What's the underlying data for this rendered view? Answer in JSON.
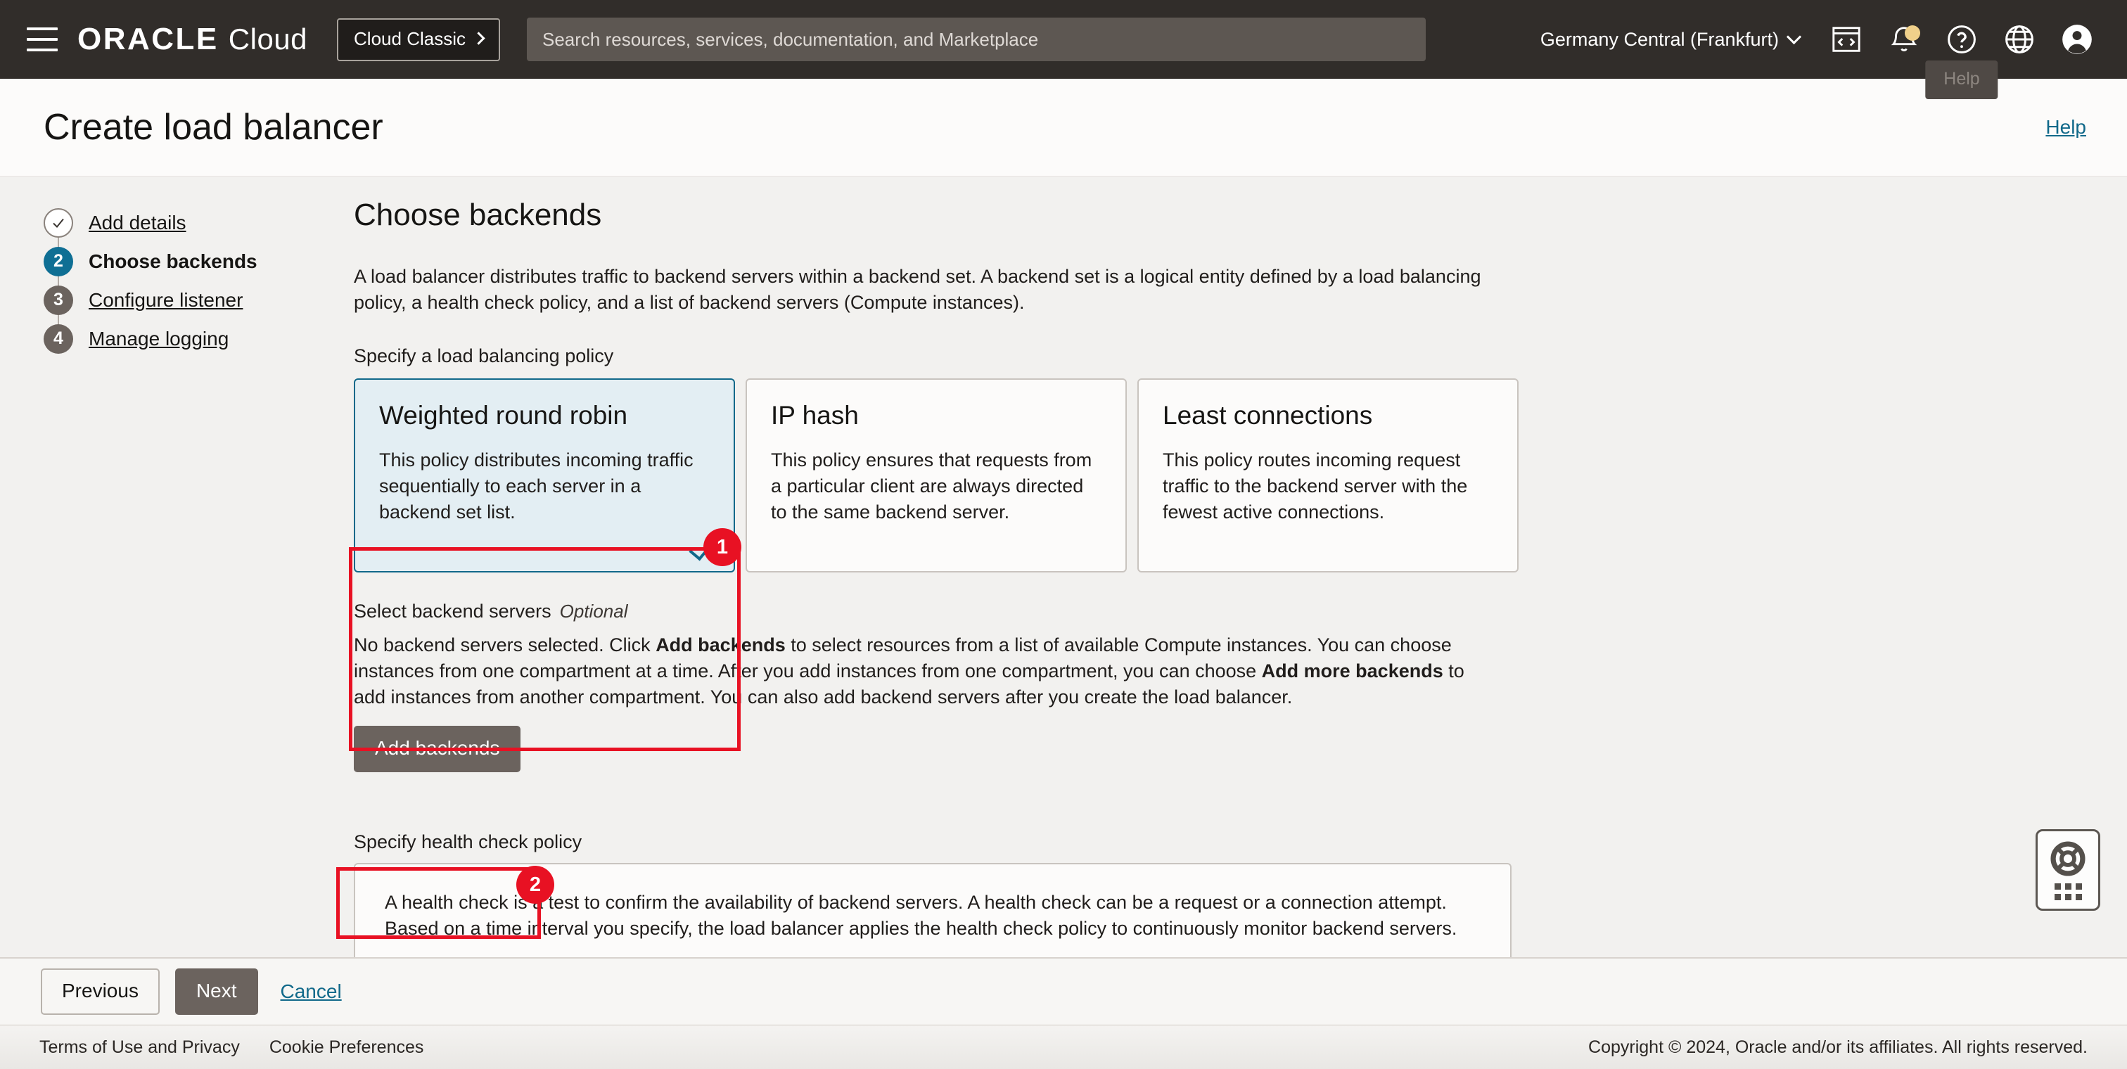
{
  "topnav": {
    "menu_icon": "hamburger-icon",
    "logo_oracle": "ORACLE",
    "logo_cloud": "Cloud",
    "cloud_classic_label": "Cloud Classic",
    "search_placeholder": "Search resources, services, documentation, and Marketplace",
    "search_value": "",
    "region": "Germany Central (Frankfurt)",
    "icons": [
      {
        "name": "cloud-shell-icon",
        "label": "Cloud Shell"
      },
      {
        "name": "notifications-bell-icon",
        "label": "Notifications",
        "has_badge": true
      },
      {
        "name": "help-question-icon",
        "label": "Help"
      },
      {
        "name": "language-globe-icon",
        "label": "Language"
      },
      {
        "name": "user-avatar-icon",
        "label": "Profile"
      }
    ],
    "tooltip": "Help"
  },
  "page": {
    "title": "Create load balancer",
    "help_link": "Help"
  },
  "steps": [
    {
      "num": "1",
      "label": "Add details",
      "state": "done"
    },
    {
      "num": "2",
      "label": "Choose backends",
      "state": "active"
    },
    {
      "num": "3",
      "label": "Configure listener",
      "state": "todo"
    },
    {
      "num": "4",
      "label": "Manage logging",
      "state": "todo"
    }
  ],
  "main": {
    "heading": "Choose backends",
    "intro": "A load balancer distributes traffic to backend servers within a backend set. A backend set is a logical entity defined by a load balancing policy, a health check policy, and a list of backend servers (Compute instances).",
    "policy_section_label": "Specify a load balancing policy",
    "policies": [
      {
        "title": "Weighted round robin",
        "desc": "This policy distributes incoming traffic sequentially to each server in a backend set list.",
        "selected": true
      },
      {
        "title": "IP hash",
        "desc": "This policy ensures that requests from a particular client are always directed to the same backend server.",
        "selected": false
      },
      {
        "title": "Least connections",
        "desc": "This policy routes incoming request traffic to the backend server with the fewest active connections.",
        "selected": false
      }
    ],
    "backend_section_label": "Select backend servers",
    "backend_optional": "Optional",
    "backend_desc_1": "No backend servers selected. Click ",
    "backend_desc_bold_1": "Add backends",
    "backend_desc_2": " to select resources from a list of available Compute instances. You can choose instances from one compartment at a time. After you add instances from one compartment, you can choose ",
    "backend_desc_bold_2": "Add more backends",
    "backend_desc_3": " to add instances from another compartment. You can also add backend servers after you create the load balancer.",
    "add_backends_label": "Add backends",
    "health_section_label": "Specify health check policy",
    "health_desc": "A health check is a test to confirm the availability of backend servers. A health check can be a request or a connection attempt. Based on a time interval you specify, the load balancer applies the health check policy to continuously monitor backend servers."
  },
  "annotations": [
    {
      "id": "1",
      "target": "weighted-round-robin-card"
    },
    {
      "id": "2",
      "target": "add-backends-button"
    }
  ],
  "actionbar": {
    "previous": "Previous",
    "next": "Next",
    "cancel": "Cancel"
  },
  "footer": {
    "terms": "Terms of Use and Privacy",
    "cookies": "Cookie Preferences",
    "copyright": "Copyright © 2024, Oracle and/or its affiliates. All rights reserved."
  },
  "support_widget": {
    "icon": "lifebuoy-icon",
    "handle": "drag-handle-dots"
  },
  "colors": {
    "nav_bg": "#312d2a",
    "accent_teal": "#11698a",
    "annotation_red": "#e81123",
    "button_gray": "#6b635e",
    "selected_card_bg": "#e3eef3"
  }
}
